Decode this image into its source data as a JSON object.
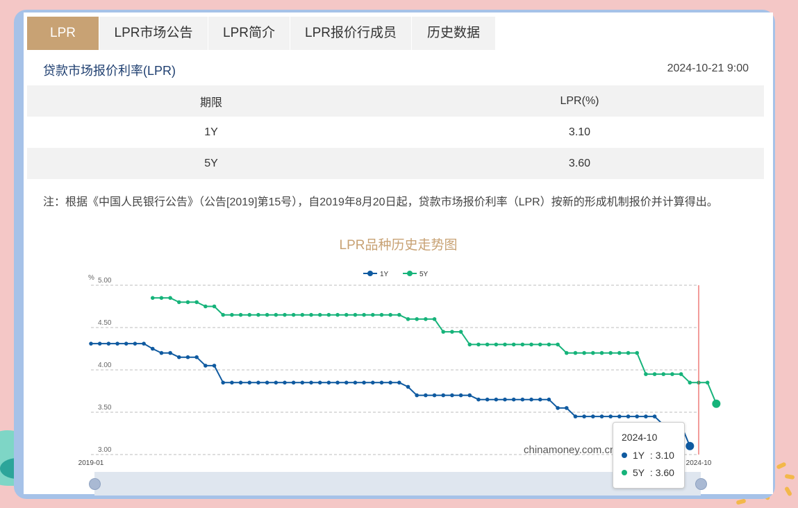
{
  "tabs": [
    {
      "label": "LPR",
      "active": true
    },
    {
      "label": "LPR市场公告",
      "active": false
    },
    {
      "label": "LPR简介",
      "active": false
    },
    {
      "label": "LPR报价行成员",
      "active": false
    },
    {
      "label": "历史数据",
      "active": false
    }
  ],
  "header": {
    "subtitle": "贷款市场报价利率(LPR)",
    "datetime": "2024-10-21 9:00"
  },
  "table": {
    "headers": [
      "期限",
      "LPR(%)"
    ],
    "rows": [
      [
        "1Y",
        "3.10"
      ],
      [
        "5Y",
        "3.60"
      ]
    ]
  },
  "note": "注：根据《中国人民银行公告》（公告[2019]第15号），自2019年8月20日起，贷款市场报价利率（LPR）按新的形成机制报价并计算得出。",
  "watermark": "chinamoney.com.cn",
  "colors": {
    "accent": "#c8a274",
    "series_1y": "#0f5aa0",
    "series_5y": "#16b37a",
    "cursor": "#e53935"
  },
  "chart_data": {
    "type": "line",
    "title": "LPR品种历史走势图",
    "ylabel": "%",
    "ylim": [
      3.0,
      5.0
    ],
    "yticks": [
      "3.00",
      "3.50",
      "4.00",
      "4.50",
      "5.00"
    ],
    "x_tick_labels": [
      "2019-01",
      "2024-10"
    ],
    "legend_position": "top-center",
    "grid": true,
    "series": [
      {
        "name": "1Y",
        "color": "#0f5aa0",
        "start": "2019-01",
        "values": [
          4.31,
          4.31,
          4.31,
          4.31,
          4.31,
          4.31,
          4.31,
          4.25,
          4.2,
          4.2,
          4.15,
          4.15,
          4.15,
          4.05,
          4.05,
          3.85,
          3.85,
          3.85,
          3.85,
          3.85,
          3.85,
          3.85,
          3.85,
          3.85,
          3.85,
          3.85,
          3.85,
          3.85,
          3.85,
          3.85,
          3.85,
          3.85,
          3.85,
          3.85,
          3.85,
          3.85,
          3.8,
          3.7,
          3.7,
          3.7,
          3.7,
          3.7,
          3.7,
          3.7,
          3.65,
          3.65,
          3.65,
          3.65,
          3.65,
          3.65,
          3.65,
          3.65,
          3.65,
          3.55,
          3.55,
          3.45,
          3.45,
          3.45,
          3.45,
          3.45,
          3.45,
          3.45,
          3.45,
          3.45,
          3.45,
          3.35,
          3.35,
          3.35,
          3.1
        ]
      },
      {
        "name": "5Y",
        "color": "#16b37a",
        "start": "2019-08",
        "values": [
          4.85,
          4.85,
          4.85,
          4.8,
          4.8,
          4.8,
          4.75,
          4.75,
          4.65,
          4.65,
          4.65,
          4.65,
          4.65,
          4.65,
          4.65,
          4.65,
          4.65,
          4.65,
          4.65,
          4.65,
          4.65,
          4.65,
          4.65,
          4.65,
          4.65,
          4.65,
          4.65,
          4.65,
          4.65,
          4.6,
          4.6,
          4.6,
          4.6,
          4.45,
          4.45,
          4.45,
          4.3,
          4.3,
          4.3,
          4.3,
          4.3,
          4.3,
          4.3,
          4.3,
          4.3,
          4.3,
          4.3,
          4.2,
          4.2,
          4.2,
          4.2,
          4.2,
          4.2,
          4.2,
          4.2,
          4.2,
          3.95,
          3.95,
          3.95,
          3.95,
          3.95,
          3.85,
          3.85,
          3.85,
          3.6
        ]
      }
    ],
    "tooltip": {
      "date": "2024-10",
      "rows": [
        {
          "name": "1Y",
          "value": "3.10"
        },
        {
          "name": "5Y",
          "value": "3.60"
        }
      ]
    }
  }
}
